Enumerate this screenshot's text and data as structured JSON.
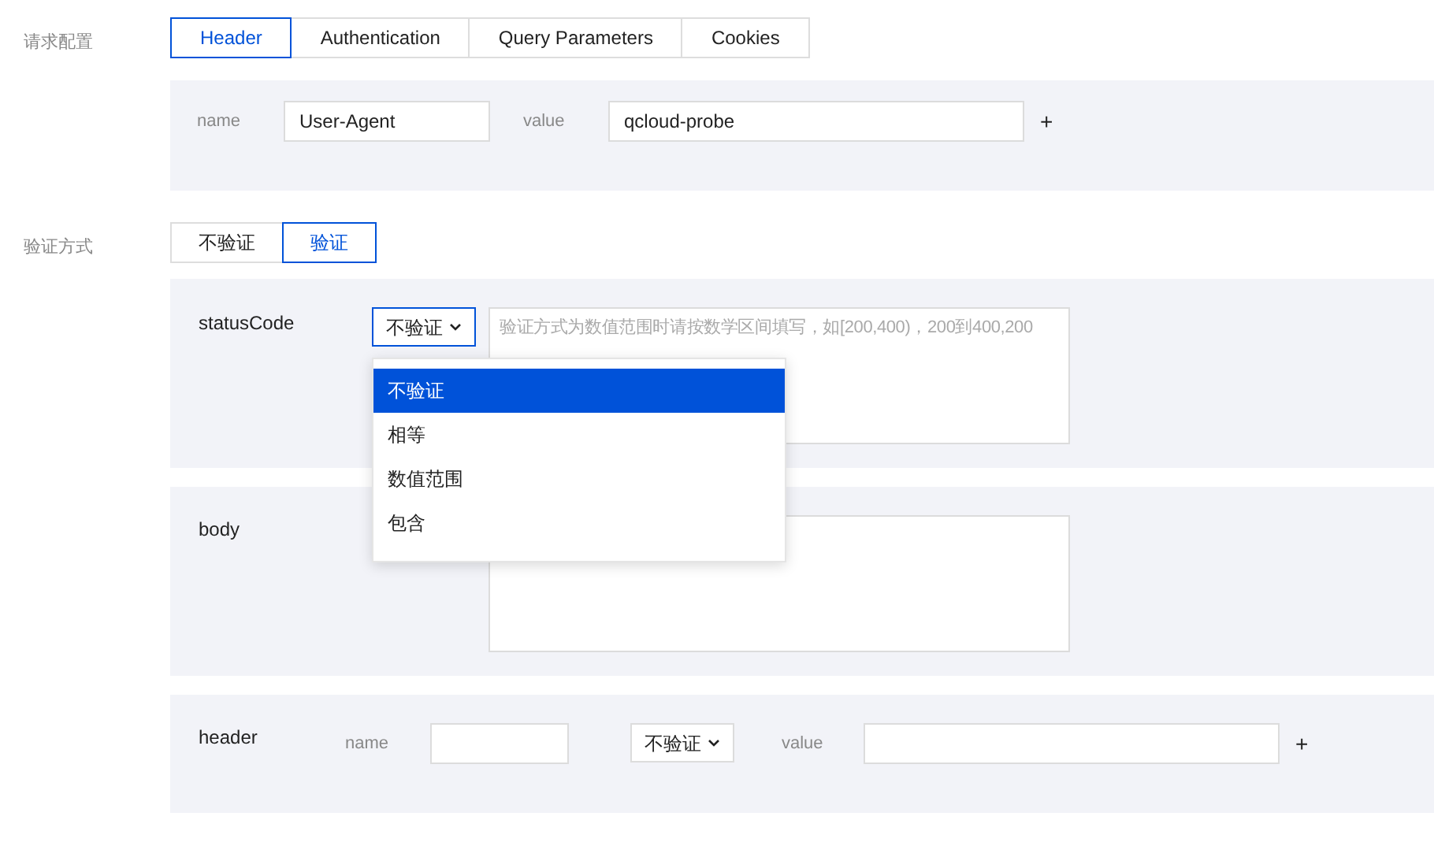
{
  "request_config": {
    "label": "请求配置",
    "tabs": [
      {
        "label": "Header",
        "selected": true
      },
      {
        "label": "Authentication",
        "selected": false
      },
      {
        "label": "Query Parameters",
        "selected": false
      },
      {
        "label": "Cookies",
        "selected": false
      }
    ],
    "headers": [
      {
        "name_label": "name",
        "name": "User-Agent",
        "value_label": "value",
        "value": "qcloud-probe",
        "add": "+"
      }
    ]
  },
  "verification": {
    "label": "验证方式",
    "modes": [
      {
        "label": "不验证",
        "selected": false
      },
      {
        "label": "验证",
        "selected": true
      }
    ],
    "status_code": {
      "label": "statusCode",
      "select": "不验证",
      "placeholder": "验证方式为数值范围时请按数学区间填写，如[200,400)，200到400,200",
      "dropdown": {
        "expanded": true,
        "options": [
          {
            "label": "不验证",
            "selected": true
          },
          {
            "label": "相等",
            "selected": false
          },
          {
            "label": "数值范围",
            "selected": false
          },
          {
            "label": "包含",
            "selected": false
          }
        ]
      }
    },
    "body": {
      "label": "body"
    },
    "header": {
      "label": "header",
      "name_label": "name",
      "select": "不验证",
      "value_label": "value",
      "add": "+"
    }
  }
}
